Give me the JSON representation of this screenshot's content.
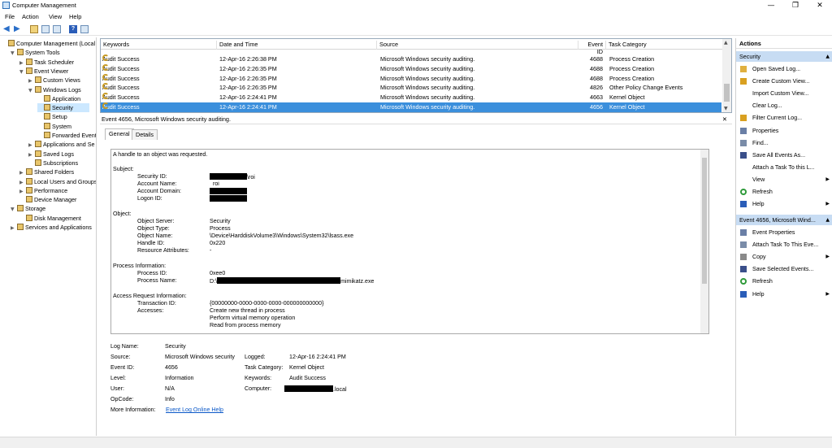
{
  "window": {
    "title": "Computer Management",
    "minimize": "—",
    "restore": "❐",
    "close": "✕"
  },
  "menu": [
    "File",
    "Action",
    "View",
    "Help"
  ],
  "tree": [
    {
      "label": "Computer Management (Local",
      "level": 0,
      "exp": ""
    },
    {
      "label": "System Tools",
      "level": 1,
      "exp": "▼"
    },
    {
      "label": "Task Scheduler",
      "level": 2,
      "exp": "▶"
    },
    {
      "label": "Event Viewer",
      "level": 2,
      "exp": "▼"
    },
    {
      "label": "Custom Views",
      "level": 3,
      "exp": "▶"
    },
    {
      "label": "Windows Logs",
      "level": 3,
      "exp": "▼"
    },
    {
      "label": "Application",
      "level": 4,
      "exp": ""
    },
    {
      "label": "Security",
      "level": 4,
      "exp": "",
      "selected": true
    },
    {
      "label": "Setup",
      "level": 4,
      "exp": ""
    },
    {
      "label": "System",
      "level": 4,
      "exp": ""
    },
    {
      "label": "Forwarded Event",
      "level": 4,
      "exp": ""
    },
    {
      "label": "Applications and Se",
      "level": 3,
      "exp": "▶"
    },
    {
      "label": "Saved Logs",
      "level": 3,
      "exp": "▶"
    },
    {
      "label": "Subscriptions",
      "level": 3,
      "exp": ""
    },
    {
      "label": "Shared Folders",
      "level": 2,
      "exp": "▶"
    },
    {
      "label": "Local Users and Groups",
      "level": 2,
      "exp": "▶"
    },
    {
      "label": "Performance",
      "level": 2,
      "exp": "▶"
    },
    {
      "label": "Device Manager",
      "level": 2,
      "exp": ""
    },
    {
      "label": "Storage",
      "level": 1,
      "exp": "▼"
    },
    {
      "label": "Disk Management",
      "level": 2,
      "exp": ""
    },
    {
      "label": "Services and Applications",
      "level": 1,
      "exp": "▶"
    }
  ],
  "grid": {
    "columns": [
      "Keywords",
      "Date and Time",
      "Source",
      "Event ID",
      "Task Category"
    ],
    "rows": [
      {
        "kw": "Audit Success",
        "dt": "12-Apr-16 2:26:38 PM",
        "src": "Microsoft Windows security auditing.",
        "id": "4688",
        "cat": "Process Creation"
      },
      {
        "kw": "Audit Success",
        "dt": "12-Apr-16 2:26:35 PM",
        "src": "Microsoft Windows security auditing.",
        "id": "4688",
        "cat": "Process Creation"
      },
      {
        "kw": "Audit Success",
        "dt": "12-Apr-16 2:26:35 PM",
        "src": "Microsoft Windows security auditing.",
        "id": "4688",
        "cat": "Process Creation"
      },
      {
        "kw": "Audit Success",
        "dt": "12-Apr-16 2:26:35 PM",
        "src": "Microsoft Windows security auditing.",
        "id": "4826",
        "cat": "Other Policy Change Events"
      },
      {
        "kw": "Audit Success",
        "dt": "12-Apr-16 2:24:41 PM",
        "src": "Microsoft Windows security auditing.",
        "id": "4663",
        "cat": "Kernel Object"
      },
      {
        "kw": "Audit Success",
        "dt": "12-Apr-16 2:24:41 PM",
        "src": "Microsoft Windows security auditing.",
        "id": "4656",
        "cat": "Kernel Object",
        "selected": true
      }
    ]
  },
  "event": {
    "header": "Event 4656, Microsoft Windows security auditing.",
    "tabs": [
      "General",
      "Details"
    ],
    "description": {
      "intro": "A handle to an object was requested.",
      "subject_label": "Subject:",
      "security_id_label": "Security ID:",
      "security_id_suffix": "\\roi",
      "account_name_label": "Account Name:",
      "account_name": "roi",
      "account_domain_label": "Account Domain:",
      "logon_id_label": "Logon ID:",
      "object_label": "Object:",
      "object_server_label": "Object Server:",
      "object_server": "Security",
      "object_type_label": "Object Type:",
      "object_type": "Process",
      "object_name_label": "Object Name:",
      "object_name": "\\Device\\HarddiskVolume3\\Windows\\System32\\lsass.exe",
      "handle_id_label": "Handle ID:",
      "handle_id": "0x220",
      "resource_attr_label": "Resource Attributes:",
      "resource_attr": "-",
      "process_info_label": "Process Information:",
      "process_id_label": "Process ID:",
      "process_id": "0xee0",
      "process_name_label": "Process Name:",
      "process_name_prefix": "D:\\",
      "process_name_suffix": "mimikatz.exe",
      "access_info_label": "Access Request Information:",
      "transaction_id_label": "Transaction ID:",
      "transaction_id": "{00000000-0000-0000-0000-000000000000}",
      "accesses_label": "Accesses:",
      "accesses": [
        "Create new thread in process",
        "Perform virtual memory operation",
        "Read from process memory"
      ]
    },
    "props": {
      "log_name_label": "Log Name:",
      "log_name": "Security",
      "source_label": "Source:",
      "source": "Microsoft Windows security",
      "logged_label": "Logged:",
      "logged": "12-Apr-16 2:24:41 PM",
      "event_id_label": "Event ID:",
      "event_id": "4656",
      "task_cat_label": "Task Category:",
      "task_cat": "Kernel Object",
      "level_label": "Level:",
      "level": "Information",
      "keywords_label": "Keywords:",
      "keywords": "Audit Success",
      "user_label": "User:",
      "user": "N/A",
      "computer_label": "Computer:",
      "computer_suffix": ".local",
      "opcode_label": "OpCode:",
      "opcode": "Info",
      "more_info_label": "More Information:",
      "more_info_link": "Event Log Online Help"
    }
  },
  "actions": {
    "title": "Actions",
    "section1": "Security",
    "items1": [
      {
        "label": "Open Saved Log...",
        "icon": "folder-icon",
        "color": "#e0b040"
      },
      {
        "label": "Create Custom View...",
        "icon": "filter-icon",
        "color": "#d9a020"
      },
      {
        "label": "Import Custom View...",
        "icon": "",
        "color": ""
      },
      {
        "label": "Clear Log...",
        "icon": "",
        "color": ""
      },
      {
        "label": "Filter Current Log...",
        "icon": "filter-icon",
        "color": "#d9a020"
      },
      {
        "label": "Properties",
        "icon": "properties-icon",
        "color": "#6a7fa6"
      },
      {
        "label": "Find...",
        "icon": "find-icon",
        "color": "#7a8ca8"
      },
      {
        "label": "Save All Events As...",
        "icon": "save-icon",
        "color": "#3a4f8a"
      },
      {
        "label": "Attach a Task To this L...",
        "icon": "",
        "color": ""
      },
      {
        "label": "View",
        "icon": "",
        "color": "",
        "sub": true
      },
      {
        "label": "Refresh",
        "icon": "refresh-icon",
        "color": "#2f9a3a"
      },
      {
        "label": "Help",
        "icon": "help-icon",
        "color": "#2a5db8",
        "sub": true
      }
    ],
    "section2": "Event 4656, Microsoft Wind...",
    "items2": [
      {
        "label": "Event Properties",
        "icon": "properties-icon",
        "color": "#6a7fa6"
      },
      {
        "label": "Attach Task To This Eve...",
        "icon": "task-icon",
        "color": "#7a8ca8"
      },
      {
        "label": "Copy",
        "icon": "copy-icon",
        "color": "#8a8a8a",
        "sub": true
      },
      {
        "label": "Save Selected Events...",
        "icon": "save-icon",
        "color": "#3a4f8a"
      },
      {
        "label": "Refresh",
        "icon": "refresh-icon",
        "color": "#2f9a3a"
      },
      {
        "label": "Help",
        "icon": "help-icon",
        "color": "#2a5db8",
        "sub": true
      }
    ]
  }
}
